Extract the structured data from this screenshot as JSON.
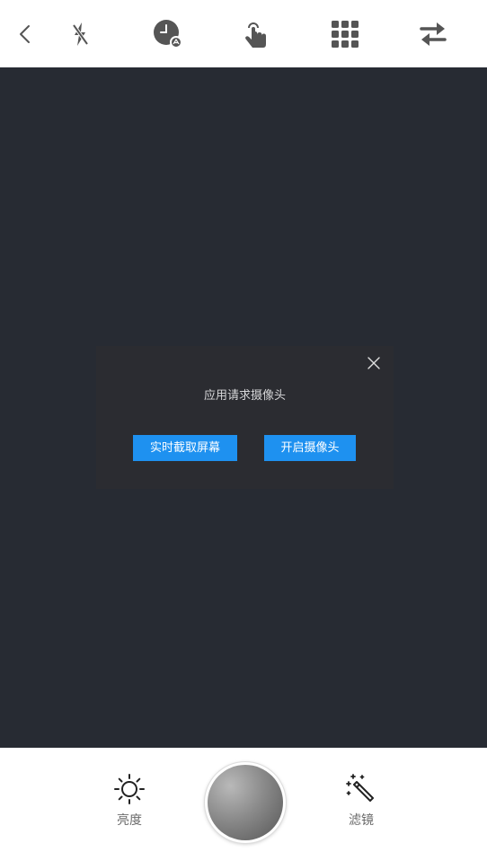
{
  "toolbar": {
    "icons": [
      "back-icon",
      "flash-off-icon",
      "timer-icon",
      "touch-icon",
      "grid-icon",
      "switch-camera-icon"
    ]
  },
  "dialog": {
    "message": "应用请求摄像头",
    "screen_capture_label": "实时截取屏幕",
    "open_camera_label": "开启摄像头"
  },
  "bottom": {
    "brightness_label": "亮度",
    "filter_label": "滤镜"
  },
  "colors": {
    "viewfinder_bg": "#272b33",
    "dialog_bg": "#2b2c31",
    "accent": "#1e91f0",
    "icon": "#555555"
  }
}
